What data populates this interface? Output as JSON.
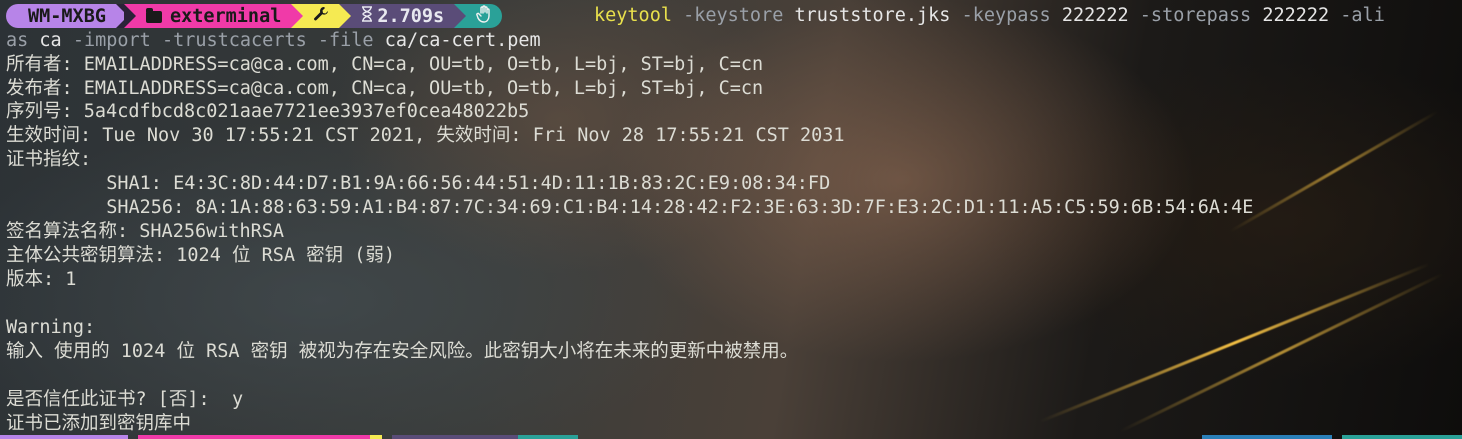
{
  "prompt": {
    "host": "WM-MXBG",
    "dir_icon": "folder-icon",
    "directory": "exterminal",
    "git_icon": "wrench-icon",
    "time_icon": "hourglass-icon",
    "duration": "2.709s",
    "status_icon": "hand-icon",
    "colors": {
      "host": "#b784e8",
      "dir": "#f03aa8",
      "git": "#f5ea52",
      "time": "#5a4c78",
      "status": "#2aa198"
    }
  },
  "command": {
    "program": "keytool",
    "part1_flag": " -keystore ",
    "part1_arg": "truststore.jks",
    "part2_flag": " -keypass ",
    "part2_arg": "222222",
    "part3_flag": " -storepass ",
    "part3_arg": "222222",
    "part4_flag": " -ali",
    "wrap_flag1": "as",
    "wrap_arg1": " ca",
    "wrap_flag2": " -import -trustcacerts -file ",
    "wrap_arg2": "ca/ca-cert.pem"
  },
  "output": [
    "所有者: EMAILADDRESS=ca@ca.com, CN=ca, OU=tb, O=tb, L=bj, ST=bj, C=cn",
    "发布者: EMAILADDRESS=ca@ca.com, CN=ca, OU=tb, O=tb, L=bj, ST=bj, C=cn",
    "序列号: 5a4cdfbcd8c021aae7721ee3937ef0cea48022b5",
    "生效时间: Tue Nov 30 17:55:21 CST 2021, 失效时间: Fri Nov 28 17:55:21 CST 2031",
    "证书指纹:",
    "         SHA1: E4:3C:8D:44:D7:B1:9A:66:56:44:51:4D:11:1B:83:2C:E9:08:34:FD",
    "         SHA256: 8A:1A:88:63:59:A1:B4:87:7C:34:69:C1:B4:14:28:42:F2:3E:63:3D:7F:E3:2C:D1:11:A5:C5:59:6B:54:6A:4E",
    "签名算法名称: SHA256withRSA",
    "主体公共密钥算法: 1024 位 RSA 密钥 (弱)",
    "版本: 1",
    "",
    "Warning:",
    "输入 使用的 1024 位 RSA 密钥 被视为存在安全风险。此密钥大小将在未来的更新中被禁用。",
    "",
    "是否信任此证书? [否]:  y",
    "证书已添加到密钥库中"
  ]
}
